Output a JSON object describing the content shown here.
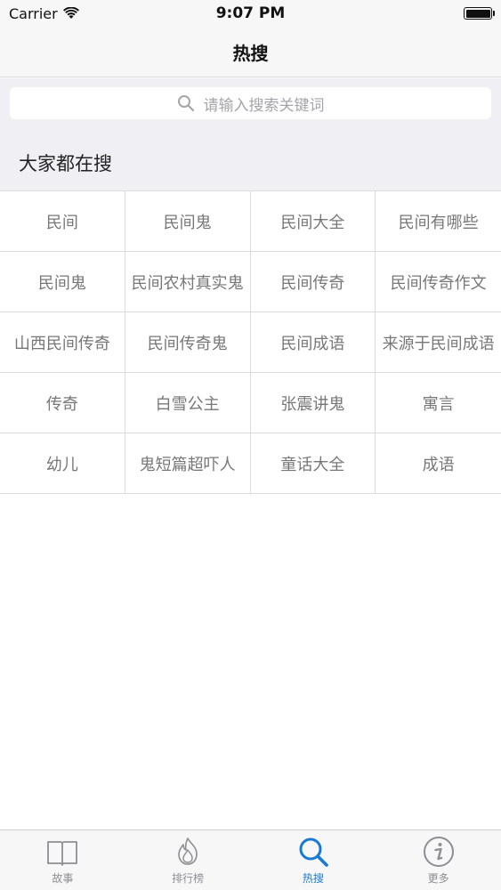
{
  "status_bar": {
    "carrier": "Carrier",
    "time": "9:07 PM"
  },
  "nav": {
    "title": "热搜"
  },
  "search": {
    "placeholder": "请输入搜索关键词"
  },
  "section": {
    "title": "大家都在搜"
  },
  "hot_terms": [
    "民间",
    "民间鬼",
    "民间大全",
    "民间有哪些",
    "民间鬼",
    "民间农村真实鬼",
    "民间传奇",
    "民间传奇作文",
    "山西民间传奇",
    "民间传奇鬼",
    "民间成语",
    "来源于民间成语",
    "传奇",
    "白雪公主",
    "张震讲鬼",
    "寓言",
    "幼儿",
    "鬼短篇超吓人",
    "童话大全",
    "成语"
  ],
  "tabs": [
    {
      "label": "故事",
      "icon": "book-icon",
      "active": false
    },
    {
      "label": "排行榜",
      "icon": "fire-icon",
      "active": false
    },
    {
      "label": "热搜",
      "icon": "search-icon",
      "active": true
    },
    {
      "label": "更多",
      "icon": "info-icon",
      "active": false
    }
  ],
  "colors": {
    "accent": "#1a7ad3",
    "inactive": "#8e8e93",
    "background": "#efeff4"
  }
}
